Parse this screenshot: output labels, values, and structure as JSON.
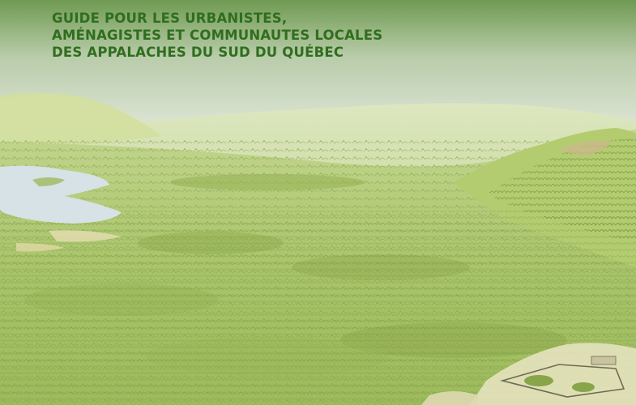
{
  "cover": {
    "subtitle_lines": [
      "GUIDE POUR LES URBANISTES,",
      "AMÉNAGISTES ET COMMUNAUTES LOCALES",
      "DES APPALACHES DU SUD DU QUÉBEC"
    ],
    "illustration": "watercolor-landscape-appalachian-valley",
    "colors": {
      "title_green": "#2f6e1e",
      "sky_top": "#6f9a52",
      "sky_bottom": "#eef1ea",
      "forest": "#a9c46a",
      "lake": "#d6e2e6"
    }
  }
}
